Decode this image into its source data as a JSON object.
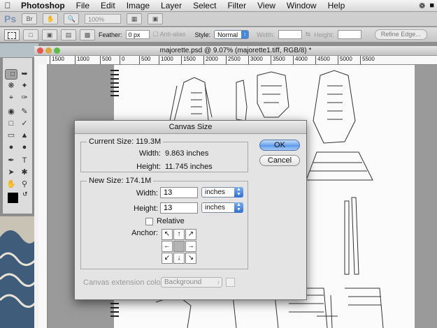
{
  "menubar": {
    "app_name": "Photoshop",
    "items": [
      "File",
      "Edit",
      "Image",
      "Layer",
      "Select",
      "Filter",
      "View",
      "Window",
      "Help"
    ]
  },
  "appbar": {
    "logo": "Ps",
    "zoom": "100%"
  },
  "options": {
    "feather_label": "Feather:",
    "feather_value": "0 px",
    "antialias_label": "Anti-alias",
    "style_label": "Style:",
    "style_value": "Normal",
    "width_label": "Width:",
    "height_label": "Height:",
    "refine_edge": "Refine Edge..."
  },
  "document": {
    "title": "majorette.psd @ 9.07% (majorette1.tiff, RGB/8) *",
    "ruler_ticks": [
      "1500",
      "1000",
      "500",
      "0",
      "500",
      "1000",
      "1500",
      "2000",
      "2500",
      "3000",
      "3500",
      "4000",
      "4500",
      "5000",
      "5500"
    ]
  },
  "dialog": {
    "title": "Canvas Size",
    "current_size": {
      "legend": "Current Size: 119.3M",
      "width_label": "Width:",
      "width_value": "9.863 inches",
      "height_label": "Height:",
      "height_value": "11.745 inches"
    },
    "new_size": {
      "legend": "New Size: 174.1M",
      "width_label": "Width:",
      "width_value": "13",
      "width_unit": "inches",
      "height_label": "Height:",
      "height_value": "13",
      "height_unit": "inches",
      "relative_label": "Relative",
      "anchor_label": "Anchor:"
    },
    "extension_label": "Canvas extension color:",
    "extension_value": "Background",
    "ok_label": "OK",
    "cancel_label": "Cancel"
  }
}
